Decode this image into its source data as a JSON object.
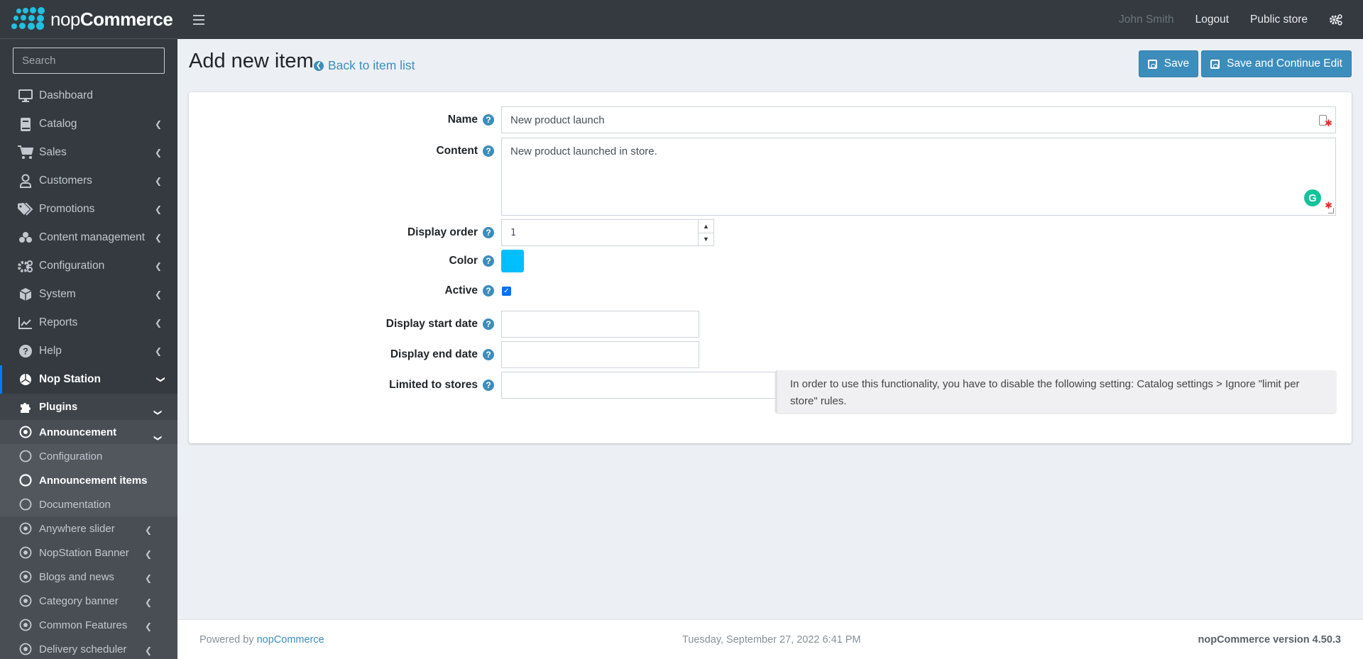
{
  "brand": {
    "prefix": "nop",
    "suffix": "Commerce"
  },
  "search": {
    "placeholder": "Search"
  },
  "topbar": {
    "user": "John Smith",
    "logout": "Logout",
    "public_store": "Public store"
  },
  "sidebar": {
    "main_items": [
      {
        "label": "Dashboard",
        "icon": "desktop-icon",
        "has_children": false
      },
      {
        "label": "Catalog",
        "icon": "book-icon",
        "has_children": true
      },
      {
        "label": "Sales",
        "icon": "cart-icon",
        "has_children": true
      },
      {
        "label": "Customers",
        "icon": "user-icon",
        "has_children": true
      },
      {
        "label": "Promotions",
        "icon": "tags-icon",
        "has_children": true
      },
      {
        "label": "Content management",
        "icon": "cubes-icon",
        "has_children": true
      },
      {
        "label": "Configuration",
        "icon": "cogs-icon",
        "has_children": true
      },
      {
        "label": "System",
        "icon": "cube-icon",
        "has_children": true
      },
      {
        "label": "Reports",
        "icon": "chart-line-icon",
        "has_children": true
      },
      {
        "label": "Help",
        "icon": "question-circle-icon",
        "has_children": true
      }
    ],
    "active_group": {
      "label": "Nop Station",
      "icon": "nopstation-icon"
    },
    "plugins": {
      "label": "Plugins",
      "icon": "puzzle-icon"
    },
    "announcement": {
      "label": "Announcement",
      "icon": "dot-circle-icon"
    },
    "announcement_children": [
      {
        "label": "Configuration",
        "current": false
      },
      {
        "label": "Announcement items",
        "current": true
      },
      {
        "label": "Documentation",
        "current": false
      }
    ],
    "plugin_items": [
      {
        "label": "Anywhere slider"
      },
      {
        "label": "NopStation Banner"
      },
      {
        "label": "Blogs and news"
      },
      {
        "label": "Category banner"
      },
      {
        "label": "Common Features"
      },
      {
        "label": "Delivery scheduler"
      }
    ]
  },
  "page": {
    "title": "Add new item",
    "back_link": "Back to item list",
    "save": "Save",
    "save_continue": "Save and Continue Edit"
  },
  "form": {
    "name": {
      "label": "Name",
      "value": "New product launch",
      "required": true
    },
    "content": {
      "label": "Content",
      "value": "New product launched in store.",
      "required": true
    },
    "display_order": {
      "label": "Display order",
      "value": "1"
    },
    "color": {
      "label": "Color",
      "value": "#00bfff"
    },
    "active": {
      "label": "Active",
      "checked": true
    },
    "display_start_date": {
      "label": "Display start date",
      "value": ""
    },
    "display_end_date": {
      "label": "Display end date",
      "value": ""
    },
    "limited_to_stores": {
      "label": "Limited to stores",
      "value": ""
    },
    "stores_info": "In order to use this functionality, you have to disable the following setting: Catalog settings > Ignore \"limit per store\" rules."
  },
  "footer": {
    "powered_by": "Powered by",
    "powered_link": "nopCommerce",
    "datetime": "Tuesday, September 27, 2022 6:41 PM",
    "version": "nopCommerce version 4.50.3"
  },
  "colors": {
    "accent": "#3c8dbc",
    "sidebar": "#343a40",
    "active_bar": "#007bff",
    "required": "#e5302e",
    "grammarly": "#15c39a"
  }
}
